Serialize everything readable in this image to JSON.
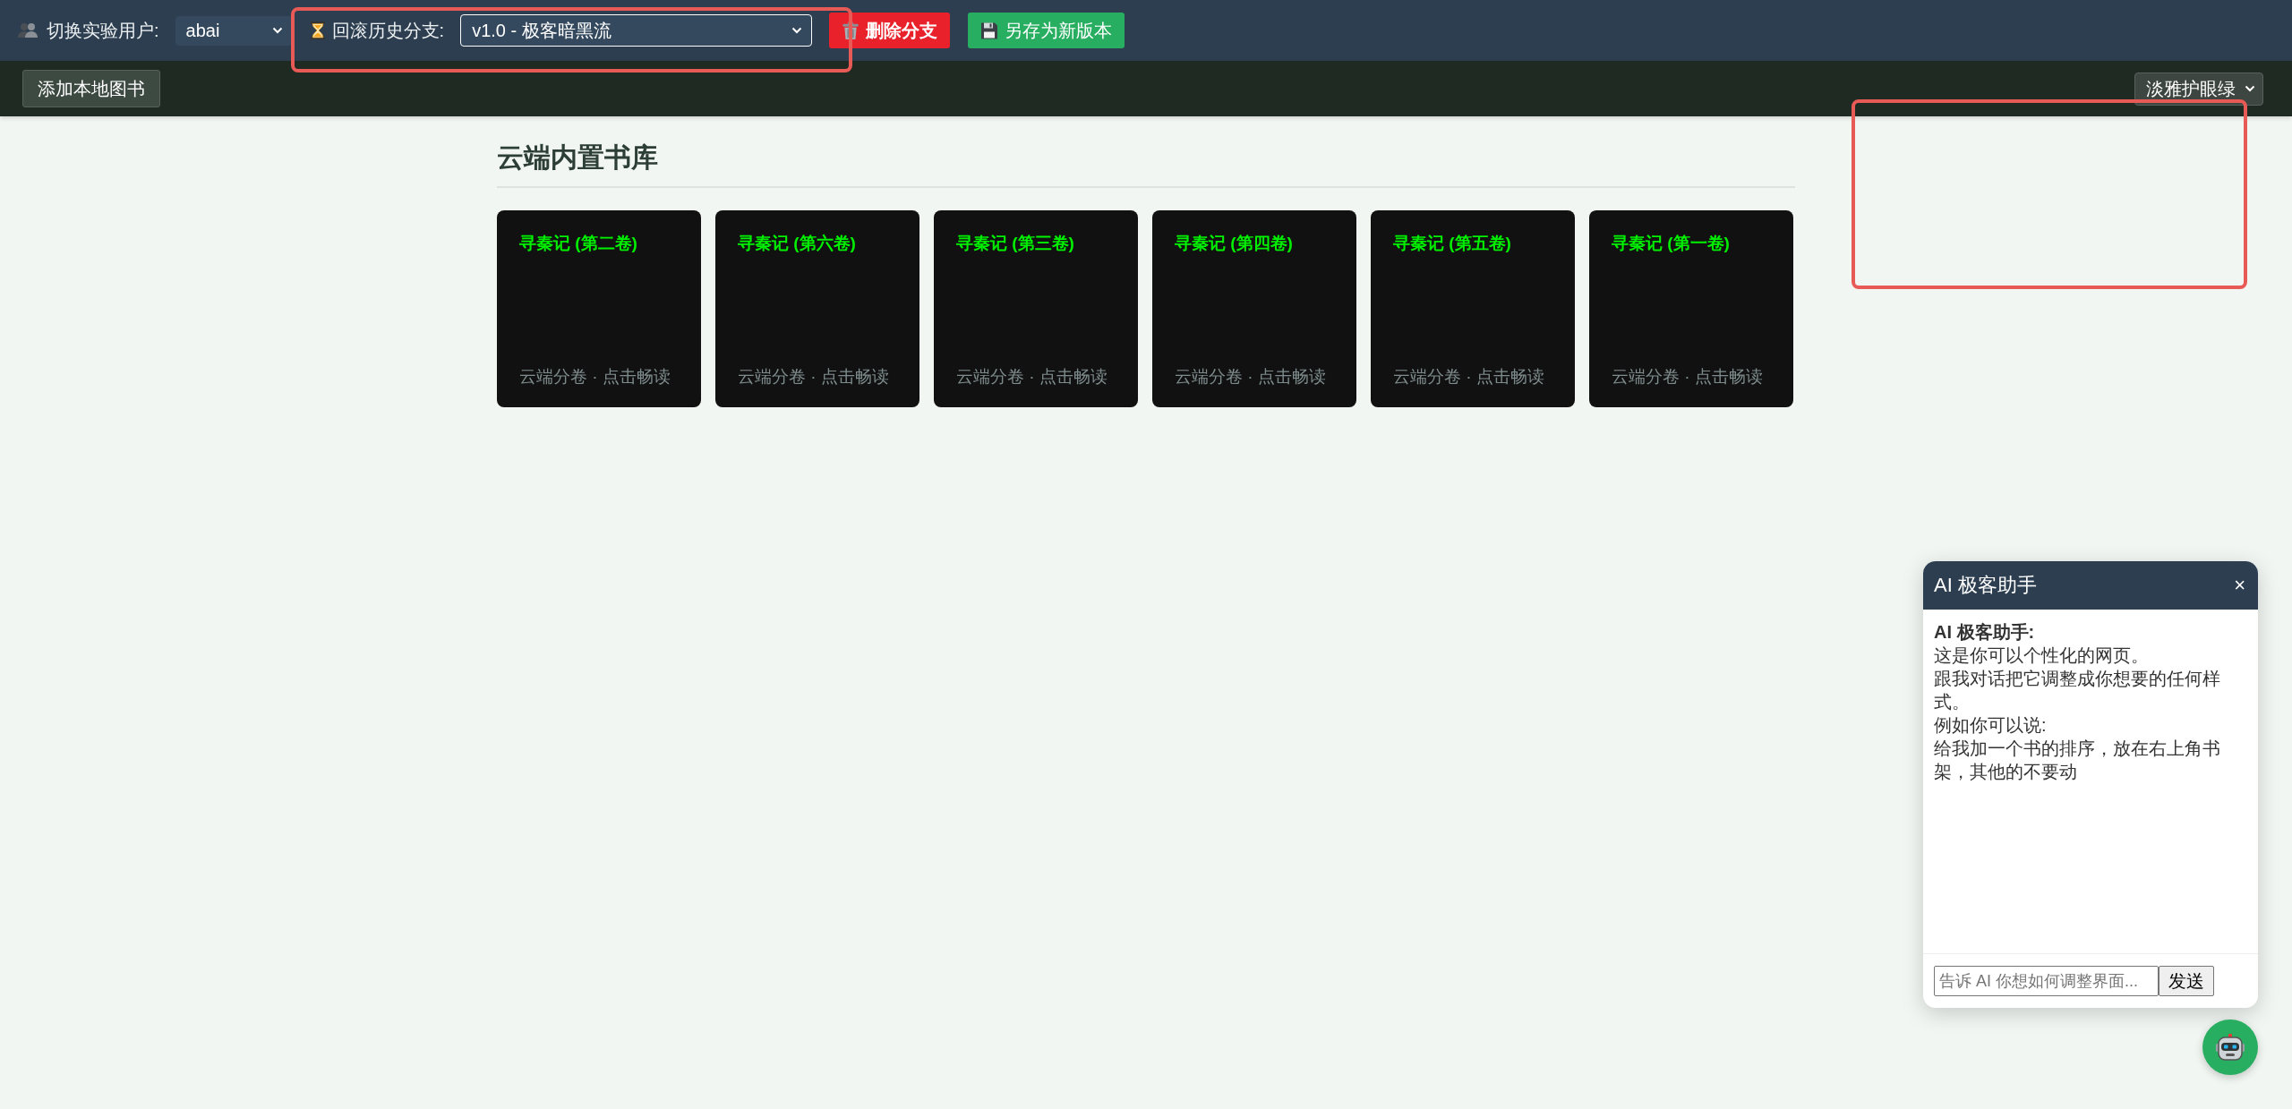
{
  "top_bar": {
    "user_label": "切换实验用户:",
    "user_select": {
      "value": "abai"
    },
    "branch_label": "回滚历史分支:",
    "branch_select": {
      "value": "v1.0 - 极客暗黑流"
    },
    "buttons": [
      {
        "label": "删除分支",
        "kind": "danger"
      },
      {
        "label": "另存为新版本",
        "kind": "save"
      }
    ]
  },
  "toolbar": {
    "add_button": "添加本地图书",
    "theme_select": {
      "value": "淡雅护眼绿"
    }
  },
  "library": {
    "title": "云端内置书库",
    "books": [
      {
        "title": "寻秦记 (第二卷)",
        "subtitle": "云端分卷 · 点击畅读"
      },
      {
        "title": "寻秦记 (第六卷)",
        "subtitle": "云端分卷 · 点击畅读"
      },
      {
        "title": "寻秦记 (第三卷)",
        "subtitle": "云端分卷 · 点击畅读"
      },
      {
        "title": "寻秦记 (第四卷)",
        "subtitle": "云端分卷 · 点击畅读"
      },
      {
        "title": "寻秦记 (第五卷)",
        "subtitle": "云端分卷 · 点击畅读"
      },
      {
        "title": "寻秦记 (第一卷)",
        "subtitle": "云端分卷 · 点击畅读"
      }
    ]
  },
  "chat": {
    "title": "AI 极客助手",
    "close": "×",
    "messages": [
      {
        "sender": "AI 极客助手:",
        "lines": [
          "这是你可以个性化的网页。",
          "跟我对话把它调整成你想要的任何样式。",
          "例如你可以说:",
          "给我加一个书的排序，放在右上角书架，其他的不要动"
        ]
      }
    ],
    "input": {
      "placeholder": "告诉 AI 你想如何调整界面..."
    },
    "send_button": "发送"
  }
}
